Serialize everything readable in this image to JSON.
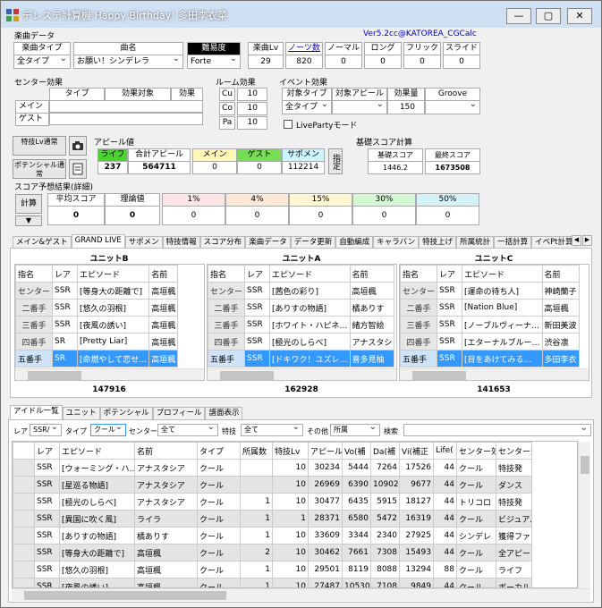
{
  "window": {
    "title": "デレステ計算機 Happy Birthday! 多田李衣菜",
    "version": "Ver5.2cc@KATOREA_CGCalc"
  },
  "song": {
    "group_label": "楽曲データ",
    "type_header": "楽曲タイプ",
    "type_value": "全タイプ",
    "name_header": "曲名",
    "name_value": "お願い！シンデレラ",
    "difficulty_header": "難易度",
    "difficulty_value": "Forte",
    "level_header": "楽曲Lv",
    "level_value": "29",
    "notes_header": "ノーツ数",
    "notes_value": "820",
    "normal_header": "ノーマル",
    "normal_value": "0",
    "long_header": "ロング",
    "long_value": "0",
    "flick_header": "フリック",
    "flick_value": "0",
    "slide_header": "スライド",
    "slide_value": "0"
  },
  "center_effect": {
    "group_label": "センター効果",
    "headers": [
      "タイプ",
      "効果対象",
      "効果"
    ],
    "rows": [
      "メイン",
      "ゲスト"
    ]
  },
  "room_effect": {
    "group_label": "ルーム効果",
    "rows": [
      {
        "label": "Cu",
        "value": "10"
      },
      {
        "label": "Co",
        "value": "10"
      },
      {
        "label": "Pa",
        "value": "10"
      }
    ]
  },
  "event_effect": {
    "group_label": "イベント効果",
    "headers": [
      "対象タイプ",
      "対象アピール",
      "効果量",
      "Groove"
    ],
    "type_value": "全タイプ",
    "amount_value": "150",
    "liveparty_label": "LivePartyモード"
  },
  "left_buttons": {
    "skill_lv": "特技Lv通常",
    "potential": "ポテンシャル通常",
    "calc": "計算",
    "arrow": "▼",
    "camera_icon": "camera-icon",
    "document_icon": "document-icon"
  },
  "appeal": {
    "group_label": "アピール値",
    "life_header": "ライフ",
    "life_value": "237",
    "total_header": "合計アピール",
    "total_value": "564711",
    "main_header": "メイン",
    "main_value": "0",
    "guest_header": "ゲスト",
    "guest_value": "0",
    "support_header": "サポメン",
    "support_value": "112214",
    "designate": "指定"
  },
  "base_score": {
    "group_label": "基礎スコア計算",
    "base_header": "基礎スコア",
    "base_value": "1446.2",
    "max_header": "最終スコア",
    "max_value": "1673508"
  },
  "prediction": {
    "group_label": "スコア予想結果(詳細)",
    "avg_header": "平均スコア",
    "avg_value": "0",
    "theory_header": "理論値",
    "theory_value": "0",
    "pct": [
      {
        "label": "1%",
        "value": "0",
        "color": "#fde4e4"
      },
      {
        "label": "4%",
        "value": "0",
        "color": "#fde7d6"
      },
      {
        "label": "15%",
        "value": "0",
        "color": "#fdf8d2"
      },
      {
        "label": "30%",
        "value": "0",
        "color": "#d4f7d4"
      },
      {
        "label": "50%",
        "value": "0",
        "color": "#d4f2f7"
      }
    ]
  },
  "main_tabs": [
    "メイン&ゲスト",
    "GRAND LIVE",
    "サポメン",
    "特技情報",
    "スコア分布",
    "楽曲データ",
    "データ更新",
    "自動編成",
    "キャラバン",
    "特技上げ",
    "所属統計",
    "一括計算",
    "イベPt計算"
  ],
  "units": [
    {
      "title": "ユニットB",
      "total": "147916",
      "headers": [
        "指名",
        "レア",
        "エピソード",
        "名前"
      ],
      "rows": [
        [
          "センター",
          "SSR",
          "[等身大の距離で]",
          "高垣楓"
        ],
        [
          "二番手",
          "SSR",
          "[悠久の羽根]",
          "高垣楓"
        ],
        [
          "三番手",
          "SSR",
          "[夜風の誘い]",
          "高垣楓"
        ],
        [
          "四番手",
          "SR",
          "[Pretty Liar]",
          "高垣楓"
        ],
        [
          "五番手",
          "SR",
          "[命燃やして恋せ…",
          "高垣楓"
        ]
      ]
    },
    {
      "title": "ユニットA",
      "total": "162928",
      "headers": [
        "指名",
        "レア",
        "エピソード",
        "名前"
      ],
      "rows": [
        [
          "センター",
          "SSR",
          "[茜色の彩り]",
          "高垣楓"
        ],
        [
          "二番手",
          "SSR",
          "[ありすの物語]",
          "橘ありす"
        ],
        [
          "三番手",
          "SSR",
          "[ホワイト・ハピネ…",
          "緒方智絵"
        ],
        [
          "四番手",
          "SSR",
          "[極光のしらべ]",
          "アナスタシ"
        ],
        [
          "五番手",
          "SSR",
          "[ドキワク！ユズレ…",
          "喜多見柚"
        ]
      ]
    },
    {
      "title": "ユニットC",
      "total": "141653",
      "headers": [
        "指名",
        "レア",
        "エピソード",
        "名前"
      ],
      "rows": [
        [
          "センター",
          "SSR",
          "[運命の待ち人]",
          "神崎蘭子"
        ],
        [
          "二番手",
          "SSR",
          "[Nation Blue]",
          "高垣楓"
        ],
        [
          "三番手",
          "SSR",
          "[ノーブルヴィーナ…",
          "新田美波"
        ],
        [
          "四番手",
          "SSR",
          "[エターナルブルー…",
          "渋谷凛"
        ],
        [
          "五番手",
          "SSR",
          "[目をあけてみる…",
          "多田李衣"
        ]
      ]
    }
  ],
  "bottom_tabs": [
    "アイドル一覧",
    "ユニット",
    "ポテンシャル",
    "プロフィール",
    "譜面表示"
  ],
  "filters": {
    "rare_label": "レア",
    "rare_value": "SSR/",
    "type_label": "タイプ",
    "type_value": "クール",
    "center_label": "センター",
    "center_value": "全て",
    "skill_label": "特技",
    "skill_value": "全て",
    "other_label": "その他",
    "other_value": "所属",
    "search_label": "検索"
  },
  "idol_list": {
    "headers": [
      "",
      "レア",
      "エピソード",
      "名前",
      "タイプ",
      "所属数",
      "特技Lv",
      "アピール",
      "Vo(補",
      "Da(補",
      "Vi(補正",
      "Life(",
      "センター効",
      "センター効"
    ],
    "rows": [
      [
        "",
        "SSR",
        "[ウォーミング・ハ…",
        "アナスタシア",
        "クール",
        "",
        "10",
        "30234",
        "5444",
        "7264",
        "17526",
        "44",
        "クール",
        "特技発"
      ],
      [
        "",
        "SSR",
        "[星巡る物語]",
        "アナスタシア",
        "クール",
        "",
        "10",
        "26969",
        "6390",
        "10902",
        "9677",
        "44",
        "クール",
        "ダンス"
      ],
      [
        "",
        "SSR",
        "[極光のしらべ]",
        "アナスタシア",
        "クール",
        "1",
        "10",
        "30477",
        "6435",
        "5915",
        "18127",
        "44",
        "トリコロ",
        "特技発"
      ],
      [
        "",
        "SSR",
        "[異国に吹く風]",
        "ライラ",
        "クール",
        "1",
        "1",
        "28371",
        "6580",
        "5472",
        "16319",
        "44",
        "クール",
        "ビジュアル"
      ],
      [
        "",
        "SSR",
        "[ありすの物語]",
        "橘ありす",
        "クール",
        "1",
        "10",
        "33609",
        "3344",
        "2340",
        "27925",
        "44",
        "シンデレ",
        "獲得ファ"
      ],
      [
        "",
        "SSR",
        "[等身大の距離で]",
        "高垣楓",
        "クール",
        "2",
        "10",
        "30462",
        "7661",
        "7308",
        "15493",
        "44",
        "クール",
        "全アピー"
      ],
      [
        "",
        "SSR",
        "[悠久の羽根]",
        "高垣楓",
        "クール",
        "1",
        "10",
        "29501",
        "8119",
        "8088",
        "13294",
        "88",
        "クール",
        "ライフ"
      ],
      [
        "",
        "SSR",
        "[夜風の誘い]",
        "高垣楓",
        "クール",
        "1",
        "10",
        "27487",
        "10530",
        "7108",
        "9849",
        "44",
        "クール",
        "ボーカル"
      ]
    ]
  }
}
